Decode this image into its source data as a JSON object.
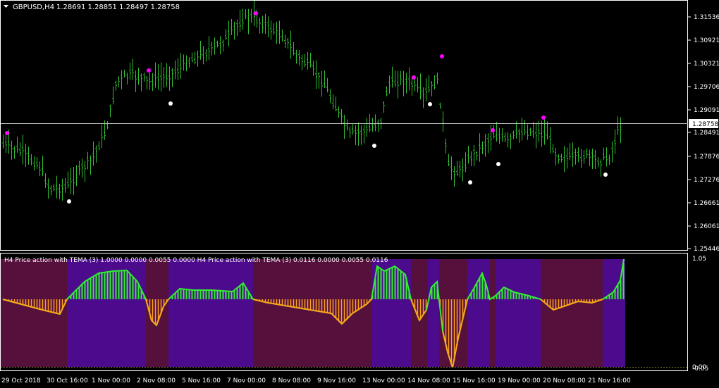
{
  "main_chart": {
    "symbol_label": "GBPUSD,H4",
    "ohlc": "1.28691 1.28851 1.28497 1.28758",
    "current_price": "1.28758",
    "y_ticks": [
      "1.31536",
      "1.30921",
      "1.30321",
      "1.29706",
      "1.29091",
      "1.28491",
      "1.27876",
      "1.27276",
      "1.26661",
      "1.26061",
      "1.25446"
    ],
    "bar_color": "#2fbf2f",
    "current_line_color": "#c0c0c0",
    "dot_colors": {
      "above": "#ff00ff",
      "below": "#ffffff"
    }
  },
  "indicator": {
    "label": "H4 Price action with TEMA (3) 1.0000 0.0000 0.0055 0.0000  H4 Price action with TEMA (3) 0.0116 0.0000 0.0055 0.0116",
    "y_top": "1.05",
    "y_bottom_1": "0.00",
    "y_bottom_2": "-0.05",
    "up_color": "#33ee33",
    "down_color": "#ffa31a",
    "bg_bull": "#4b0b8c",
    "bg_bear": "#56103c"
  },
  "x_labels": [
    "29 Oct 2018",
    "30 Oct 16:00",
    "1 Nov 00:00",
    "2 Nov 08:00",
    "5 Nov 16:00",
    "7 Nov 00:00",
    "8 Nov 08:00",
    "9 Nov 16:00",
    "13 Nov 00:00",
    "14 Nov 08:00",
    "15 Nov 16:00",
    "19 Nov 00:00",
    "20 Nov 08:00",
    "21 Nov 16:00"
  ]
}
